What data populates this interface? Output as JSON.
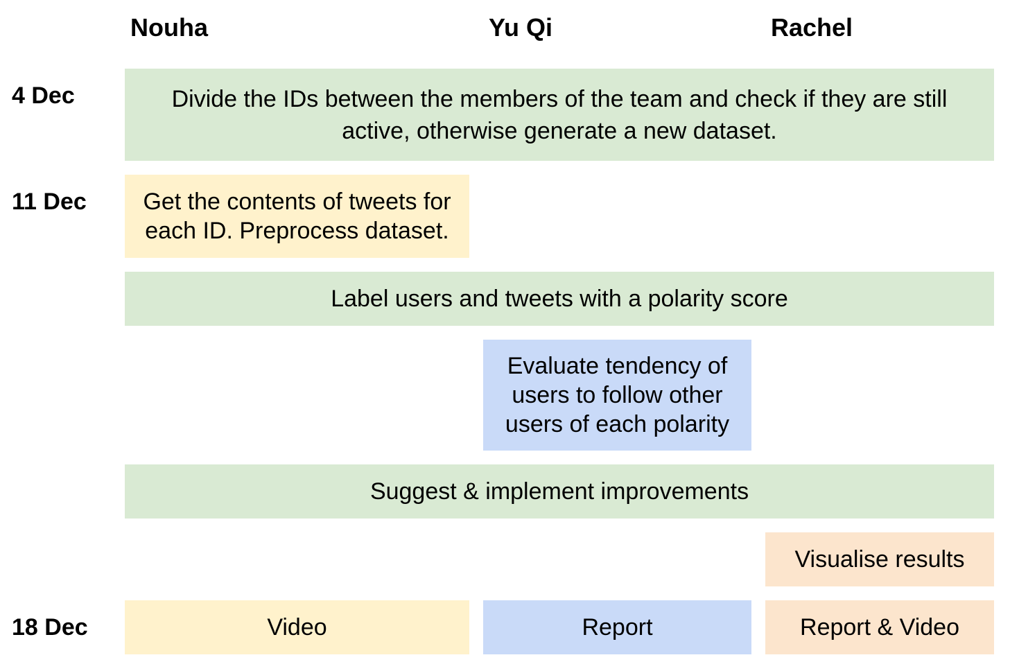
{
  "headers": {
    "member_1": "Nouha",
    "member_2": "Yu Qi",
    "member_3": "Rachel"
  },
  "dates": {
    "row_1": "4 Dec",
    "row_2": "11 Dec",
    "row_3": "18 Dec"
  },
  "tasks": {
    "divide_ids": "Divide the IDs between the members of the team and check if they are still active, otherwise generate a new dataset.",
    "get_tweets": "Get the contents of tweets for each ID. Preprocess dataset.",
    "label_users": "Label users and tweets with a polarity score",
    "evaluate_tendency": "Evaluate tendency of users to follow other users of each polarity",
    "suggest_improvements": "Suggest & implement improvements",
    "visualise_results": "Visualise results",
    "video": "Video",
    "report": "Report",
    "report_video": "Report & Video"
  },
  "colors": {
    "all_members": "#d9ead3",
    "nouha": "#fff2cc",
    "yu_qi": "#c9daf8",
    "rachel": "#fce5cd"
  }
}
